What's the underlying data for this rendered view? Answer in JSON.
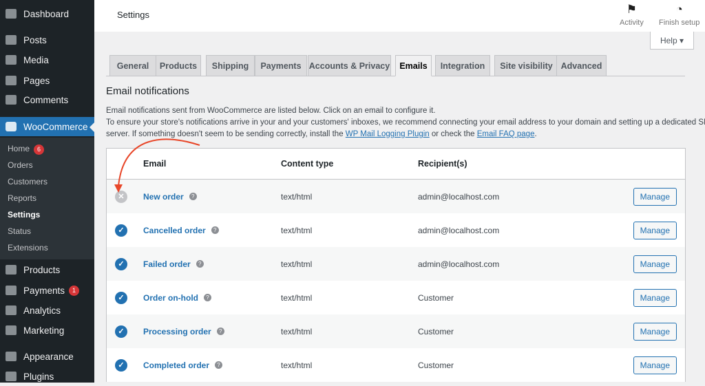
{
  "sidebar": {
    "items": [
      {
        "label": "Dashboard",
        "icon": "dashboard-icon"
      },
      {
        "label": "Posts",
        "icon": "pin-icon"
      },
      {
        "label": "Media",
        "icon": "media-icon"
      },
      {
        "label": "Pages",
        "icon": "pages-icon"
      },
      {
        "label": "Comments",
        "icon": "comment-icon"
      },
      {
        "label": "WooCommerce",
        "icon": "woo-icon"
      },
      {
        "label": "Products",
        "icon": "archive-icon"
      },
      {
        "label": "Payments",
        "icon": "dollar-icon",
        "badge": "1"
      },
      {
        "label": "Analytics",
        "icon": "bar-chart-icon"
      },
      {
        "label": "Marketing",
        "icon": "megaphone-icon"
      },
      {
        "label": "Appearance",
        "icon": "brush-icon"
      },
      {
        "label": "Plugins",
        "icon": "plug-icon"
      }
    ],
    "submenu": [
      {
        "label": "Home",
        "badge": "6"
      },
      {
        "label": "Orders"
      },
      {
        "label": "Customers"
      },
      {
        "label": "Reports"
      },
      {
        "label": "Settings"
      },
      {
        "label": "Status"
      },
      {
        "label": "Extensions"
      }
    ]
  },
  "header": {
    "title": "Settings",
    "activity": "Activity",
    "finish_setup": "Finish setup",
    "help": "Help ▾"
  },
  "tabs": [
    "General",
    "Products",
    "Shipping",
    "Payments",
    "Accounts & Privacy",
    "Emails",
    "Integration",
    "Site visibility",
    "Advanced"
  ],
  "active_tab": "Emails",
  "section": {
    "title": "Email notifications",
    "line1": "Email notifications sent from WooCommerce are listed below. Click on an email to configure it.",
    "line2": "To ensure your store's notifications arrive in your and your customers' inboxes, we recommend connecting your email address to your domain and setting up a dedicated SMTP",
    "line3a": "server. If something doesn't seem to be sending correctly, install the ",
    "link1": "WP Mail Logging Plugin",
    "line3b": " or check the ",
    "link2": "Email FAQ page",
    "line3c": "."
  },
  "table": {
    "headers": [
      "Email",
      "Content type",
      "Recipient(s)"
    ],
    "manage": "Manage",
    "rows": [
      {
        "name": "New order",
        "type": "text/html",
        "recipient": "admin@localhost.com",
        "enabled": false
      },
      {
        "name": "Cancelled order",
        "type": "text/html",
        "recipient": "admin@localhost.com",
        "enabled": true
      },
      {
        "name": "Failed order",
        "type": "text/html",
        "recipient": "admin@localhost.com",
        "enabled": true
      },
      {
        "name": "Order on-hold",
        "type": "text/html",
        "recipient": "Customer",
        "enabled": true
      },
      {
        "name": "Processing order",
        "type": "text/html",
        "recipient": "Customer",
        "enabled": true
      },
      {
        "name": "Completed order",
        "type": "text/html",
        "recipient": "Customer",
        "enabled": true
      }
    ]
  }
}
